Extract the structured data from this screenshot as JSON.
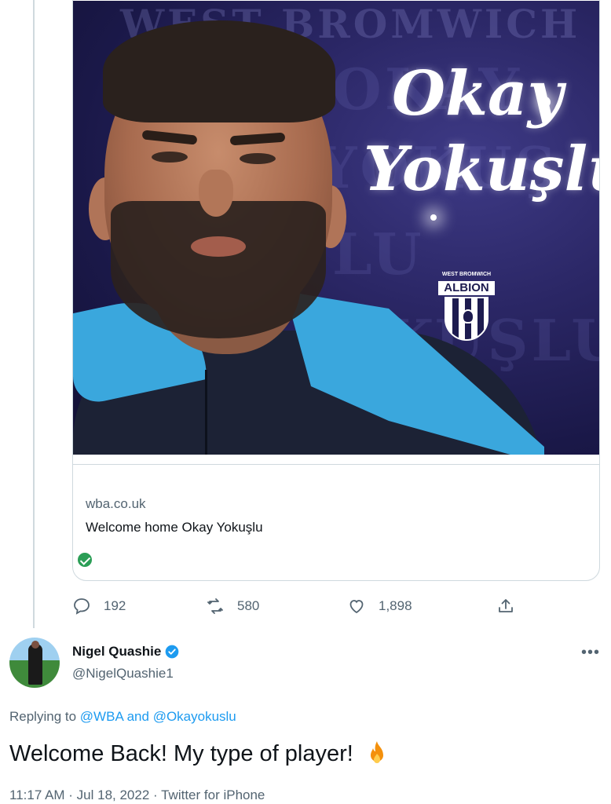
{
  "card": {
    "image": {
      "background_words": [
        "WEST BROMWICH",
        "OKAY",
        "YOKUŞ",
        "LU",
        "OKUŞLU"
      ],
      "name_first": "Okay",
      "name_last": "Yokuşlu",
      "crest_top": "WEST BROMWICH",
      "crest_name": "ALBION"
    },
    "domain": "wba.co.uk",
    "title": "Welcome home Okay Yokuşlu"
  },
  "actions": {
    "reply_count": "192",
    "retweet_count": "580",
    "like_count": "1,898"
  },
  "reply": {
    "name": "Nigel Quashie",
    "handle": "@NigelQuashie1",
    "replying_prefix": "Replying to",
    "mention_1": "@WBA",
    "and_text": "and",
    "mention_2": "@Okayokuslu",
    "text": "Welcome Back! My type of player!",
    "meta": "11:17 AM · Jul 18, 2022 · Twitter for iPhone"
  },
  "icons": {
    "reply": "reply-icon",
    "retweet": "retweet-icon",
    "like": "heart-icon",
    "share": "share-icon",
    "verified": "verified-badge-icon",
    "more": "more-icon",
    "fire": "fire-emoji"
  },
  "colors": {
    "accent": "#1d9bf0",
    "secondary_text": "#536471",
    "verified_green": "#2b9e56",
    "image_bg": "#2b2766"
  }
}
